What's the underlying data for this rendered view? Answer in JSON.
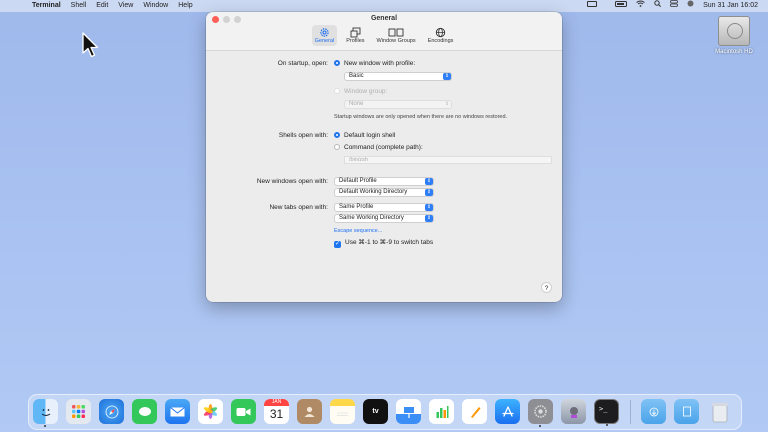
{
  "menubar": {
    "app_name": "Terminal",
    "items": [
      "Shell",
      "Edit",
      "View",
      "Window",
      "Help"
    ],
    "clock": "Sun 31 Jan  16:02"
  },
  "desktop": {
    "drive_label": "Macintosh HD"
  },
  "window": {
    "title": "General",
    "tabs": [
      {
        "label": "General",
        "icon": "gear-icon",
        "active": true
      },
      {
        "label": "Profiles",
        "icon": "profiles-icon",
        "active": false
      },
      {
        "label": "Window Groups",
        "icon": "window-groups-icon",
        "active": false
      },
      {
        "label": "Encodings",
        "icon": "globe-icon",
        "active": false
      }
    ],
    "startup": {
      "label": "On startup, open:",
      "option_new_window": "New window with profile:",
      "profile_value": "Basic",
      "option_window_group": "Window group:",
      "window_group_value": "None",
      "note": "Startup windows are only opened when there are no windows restored."
    },
    "shells": {
      "label": "Shells open with:",
      "option_default": "Default login shell",
      "option_command": "Command (complete path):",
      "command_placeholder": "/bin/zsh"
    },
    "new_windows": {
      "label": "New windows open with:",
      "profile_value": "Default Profile",
      "directory_value": "Default Working Directory"
    },
    "new_tabs": {
      "label": "New tabs open with:",
      "profile_value": "Same Profile",
      "directory_value": "Same Working Directory"
    },
    "escape_link": "Escape sequence...",
    "switch_tabs_checkbox": "Use ⌘-1 to ⌘-9 to switch tabs",
    "help_label": "?"
  },
  "dock": {
    "apps": [
      "Finder",
      "Launchpad",
      "Safari",
      "Messages",
      "Mail",
      "Photos",
      "FaceTime",
      "Calendar",
      "Contacts",
      "Notes",
      "Apple TV",
      "Keynote",
      "Numbers",
      "Pages",
      "App Store",
      "System Preferences",
      "Automator",
      "Terminal"
    ],
    "calendar_month": "JAN",
    "calendar_day": "31",
    "extras": [
      "Downloads",
      "Documents",
      "Trash"
    ]
  },
  "colors": {
    "accent": "#1f74f0",
    "close_light": "#fe5f57"
  }
}
